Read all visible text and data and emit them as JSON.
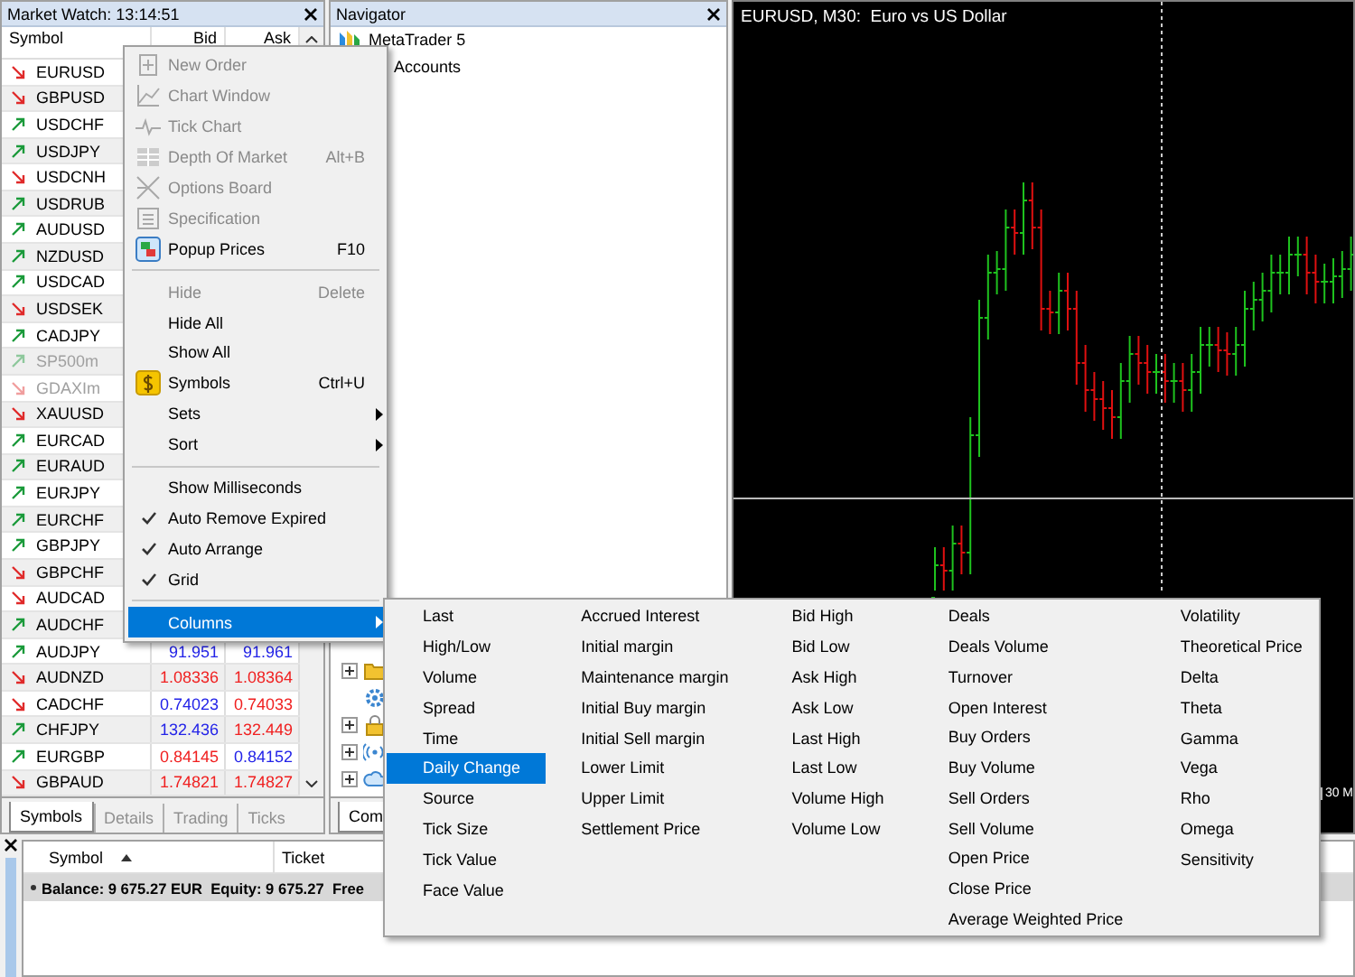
{
  "market_watch": {
    "title": "Market Watch: 13:14:51",
    "columns": [
      "Symbol",
      "Bid",
      "Ask"
    ],
    "rows": [
      {
        "symbol": "EURUSD",
        "rising": false,
        "disabled": false
      },
      {
        "symbol": "GBPUSD",
        "rising": false,
        "disabled": false
      },
      {
        "symbol": "USDCHF",
        "rising": true,
        "disabled": false
      },
      {
        "symbol": "USDJPY",
        "rising": true,
        "disabled": false
      },
      {
        "symbol": "USDCNH",
        "rising": false,
        "disabled": false
      },
      {
        "symbol": "USDRUB",
        "rising": true,
        "disabled": false
      },
      {
        "symbol": "AUDUSD",
        "rising": true,
        "disabled": false
      },
      {
        "symbol": "NZDUSD",
        "rising": true,
        "disabled": false
      },
      {
        "symbol": "USDCAD",
        "rising": true,
        "disabled": false
      },
      {
        "symbol": "USDSEK",
        "rising": false,
        "disabled": false
      },
      {
        "symbol": "CADJPY",
        "rising": true,
        "disabled": false
      },
      {
        "symbol": "SP500m",
        "rising": true,
        "disabled": true
      },
      {
        "symbol": "GDAXIm",
        "rising": false,
        "disabled": true
      },
      {
        "symbol": "XAUUSD",
        "rising": false,
        "disabled": false
      },
      {
        "symbol": "EURCAD",
        "rising": true,
        "disabled": false
      },
      {
        "symbol": "EURAUD",
        "rising": true,
        "disabled": false
      },
      {
        "symbol": "EURJPY",
        "rising": true,
        "disabled": false
      },
      {
        "symbol": "EURCHF",
        "rising": true,
        "disabled": false
      },
      {
        "symbol": "GBPJPY",
        "rising": true,
        "disabled": false
      },
      {
        "symbol": "GBPCHF",
        "rising": false,
        "disabled": false
      },
      {
        "symbol": "AUDCAD",
        "rising": false,
        "disabled": false
      },
      {
        "symbol": "AUDCHF",
        "rising": true,
        "disabled": false
      },
      {
        "symbol": "AUDJPY",
        "rising": true,
        "disabled": false,
        "bid": "91.951",
        "bid_rising": true,
        "ask": "91.961",
        "ask_rising": true
      },
      {
        "symbol": "AUDNZD",
        "rising": false,
        "disabled": false,
        "bid": "1.08336",
        "bid_rising": false,
        "ask": "1.08364",
        "ask_rising": false
      },
      {
        "symbol": "CADCHF",
        "rising": false,
        "disabled": false,
        "bid": "0.74023",
        "bid_rising": true,
        "ask": "0.74033",
        "ask_rising": false
      },
      {
        "symbol": "CHFJPY",
        "rising": true,
        "disabled": false,
        "bid": "132.436",
        "bid_rising": true,
        "ask": "132.449",
        "ask_rising": false
      },
      {
        "symbol": "EURGBP",
        "rising": true,
        "disabled": false,
        "bid": "0.84145",
        "bid_rising": false,
        "ask": "0.84152",
        "ask_rising": true
      },
      {
        "symbol": "GBPAUD",
        "rising": false,
        "disabled": false,
        "bid": "1.74821",
        "bid_rising": false,
        "ask": "1.74827",
        "ask_rising": false
      }
    ],
    "tabs": [
      {
        "label": "Symbols",
        "selected": true
      },
      {
        "label": "Details",
        "selected": false
      },
      {
        "label": "Trading",
        "selected": false
      },
      {
        "label": "Ticks",
        "selected": false
      }
    ]
  },
  "navigator": {
    "title": "Navigator",
    "tree": [
      {
        "label": "MetaTrader 5",
        "children": [
          {
            "label": "Accounts"
          }
        ]
      }
    ],
    "lower_items": [
      {
        "kind": "folder",
        "expanded": false
      },
      {
        "kind": "leaf"
      },
      {
        "kind": "folder",
        "expanded": false
      },
      {
        "kind": "folder",
        "expanded": false
      },
      {
        "kind": "folder",
        "expanded": false
      }
    ],
    "tabs": [
      {
        "label": "Com",
        "selected": true
      }
    ]
  },
  "chart": {
    "title": "EURUSD, M30:  Euro vs US Dollar",
    "time_label": "30 M"
  },
  "context_menu": {
    "items": [
      {
        "kind": "command",
        "label": "New Order",
        "disabled": true,
        "selected": false
      },
      {
        "kind": "command",
        "label": "Chart Window",
        "disabled": true,
        "selected": false
      },
      {
        "kind": "command",
        "label": "Tick Chart",
        "disabled": true,
        "selected": false
      },
      {
        "kind": "command",
        "label": "Depth Of Market",
        "shortcut": "Alt+B",
        "disabled": true,
        "selected": false
      },
      {
        "kind": "command",
        "label": "Options Board",
        "disabled": true,
        "selected": false
      },
      {
        "kind": "command",
        "label": "Specification",
        "disabled": true,
        "selected": false
      },
      {
        "kind": "command",
        "label": "Popup Prices",
        "shortcut": "F10",
        "disabled": false,
        "selected": false
      },
      {
        "kind": "separator"
      },
      {
        "kind": "command",
        "label": "Hide",
        "shortcut": "Delete",
        "disabled": true,
        "selected": false
      },
      {
        "kind": "command",
        "label": "Hide All",
        "disabled": false,
        "selected": false
      },
      {
        "kind": "command",
        "label": "Show All",
        "disabled": false,
        "selected": false
      },
      {
        "kind": "command",
        "label": "Symbols",
        "shortcut": "Ctrl+U",
        "disabled": false,
        "selected": false
      },
      {
        "kind": "submenu",
        "label": "Sets",
        "disabled": false,
        "selected": false
      },
      {
        "kind": "submenu",
        "label": "Sort",
        "disabled": false,
        "selected": false
      },
      {
        "kind": "separator"
      },
      {
        "kind": "toggle",
        "label": "Show Milliseconds",
        "checked": false,
        "disabled": false,
        "selected": false
      },
      {
        "kind": "toggle",
        "label": "Auto Remove Expired",
        "checked": true,
        "disabled": false,
        "selected": false
      },
      {
        "kind": "toggle",
        "label": "Auto Arrange",
        "checked": true,
        "disabled": false,
        "selected": false
      },
      {
        "kind": "toggle",
        "label": "Grid",
        "checked": true,
        "disabled": false,
        "selected": false
      },
      {
        "kind": "separator"
      },
      {
        "kind": "submenu",
        "label": "Columns",
        "disabled": false,
        "selected": true
      }
    ]
  },
  "columns_menu": {
    "columns": [
      {
        "items": [
          {
            "label": "Last",
            "selected": false
          },
          {
            "label": "High/Low",
            "selected": false
          },
          {
            "label": "Volume",
            "selected": false
          },
          {
            "label": "Spread",
            "selected": false
          },
          {
            "label": "Time",
            "selected": false
          },
          {
            "label": "Daily Change",
            "selected": true
          },
          {
            "label": "Source",
            "selected": false
          },
          {
            "label": "Tick Size",
            "selected": false
          },
          {
            "label": "Tick Value",
            "selected": false
          },
          {
            "label": "Face Value",
            "selected": false
          }
        ]
      },
      {
        "items": [
          {
            "label": "Accrued Interest",
            "selected": false
          },
          {
            "label": "Initial margin",
            "selected": false
          },
          {
            "label": "Maintenance margin",
            "selected": false
          },
          {
            "label": "Initial Buy margin",
            "selected": false
          },
          {
            "label": "Initial Sell margin",
            "selected": false
          },
          {
            "label": "Lower Limit",
            "selected": false
          },
          {
            "label": "Upper Limit",
            "selected": false
          },
          {
            "label": "Settlement Price",
            "selected": false
          }
        ]
      },
      {
        "items": [
          {
            "label": "Bid High",
            "selected": false
          },
          {
            "label": "Bid Low",
            "selected": false
          },
          {
            "label": "Ask High",
            "selected": false
          },
          {
            "label": "Ask Low",
            "selected": false
          },
          {
            "label": "Last High",
            "selected": false
          },
          {
            "label": "Last Low",
            "selected": false
          },
          {
            "label": "Volume High",
            "selected": false
          },
          {
            "label": "Volume Low",
            "selected": false
          }
        ]
      },
      {
        "items": [
          {
            "label": "Deals",
            "selected": false
          },
          {
            "label": "Deals Volume",
            "selected": false
          },
          {
            "label": "Turnover",
            "selected": false
          },
          {
            "label": "Open Interest",
            "selected": false
          },
          {
            "label": "Buy Orders",
            "selected": false
          },
          {
            "label": "Buy Volume",
            "selected": false
          },
          {
            "label": "Sell Orders",
            "selected": false
          },
          {
            "label": "Sell Volume",
            "selected": false
          },
          {
            "label": "Open Price",
            "selected": false
          },
          {
            "label": "Close Price",
            "selected": false
          },
          {
            "label": "Average Weighted Price",
            "selected": false
          }
        ]
      },
      {
        "items": [
          {
            "label": "Volatility",
            "selected": false
          },
          {
            "label": "Theoretical Price",
            "selected": false
          },
          {
            "label": "Delta",
            "selected": false
          },
          {
            "label": "Theta",
            "selected": false
          },
          {
            "label": "Gamma",
            "selected": false
          },
          {
            "label": "Vega",
            "selected": false
          },
          {
            "label": "Rho",
            "selected": false
          },
          {
            "label": "Omega",
            "selected": false
          },
          {
            "label": "Sensitivity",
            "selected": false
          }
        ]
      }
    ]
  },
  "toolbox": {
    "columns": [
      {
        "label": "Symbol",
        "sorted": true
      },
      {
        "label": "Ticket",
        "sorted": false
      }
    ],
    "balance_row": "Balance: 9 675.27 EUR  Equity: 9 675.27  Free"
  }
}
